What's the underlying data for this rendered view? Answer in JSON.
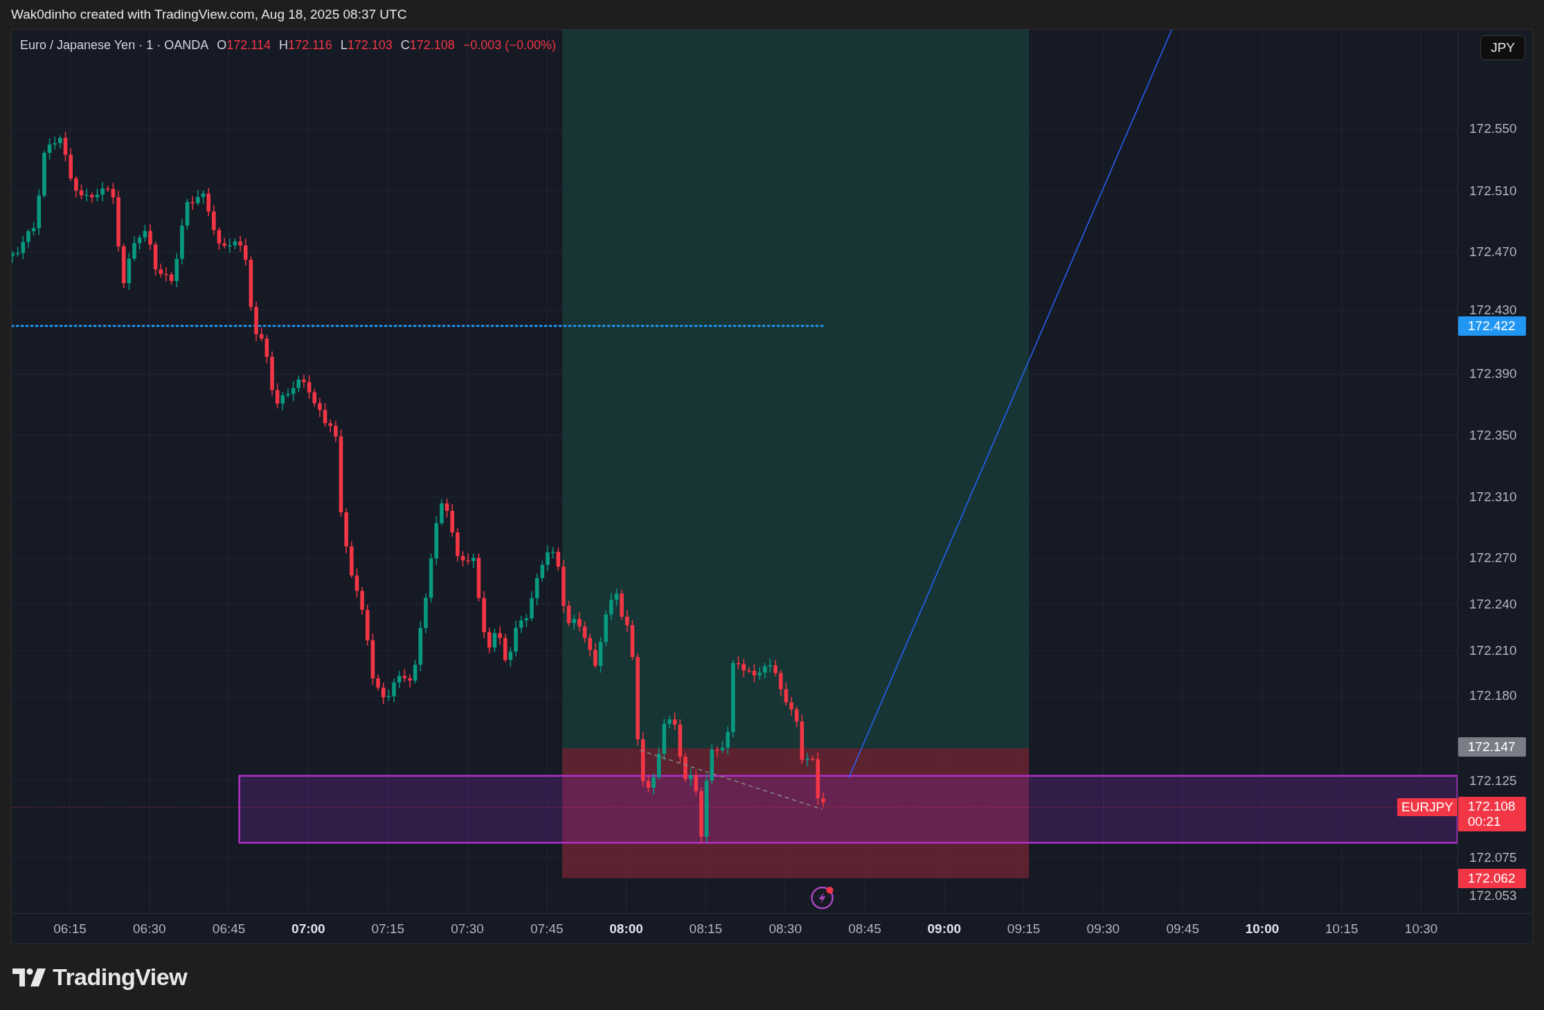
{
  "header": {
    "caption": "Wak0dinho created with TradingView.com, Aug 18, 2025 08:37 UTC"
  },
  "legend": {
    "symbol": "Euro / Japanese Yen · 1 · OANDA",
    "values": [
      {
        "label": "O",
        "value": "172.114"
      },
      {
        "label": "H",
        "value": "172.116"
      },
      {
        "label": "L",
        "value": "172.103"
      },
      {
        "label": "C",
        "value": "172.108"
      }
    ],
    "change": "−0.003 (−0.00%)"
  },
  "currency_button": "JPY",
  "price_axis": [
    "172.550",
    "172.510",
    "172.470",
    "172.430",
    "172.390",
    "172.350",
    "172.310",
    "172.270",
    "172.240",
    "172.210",
    "172.180",
    "172.125",
    "172.075",
    "172.053"
  ],
  "price_badges": [
    {
      "kind": "alert",
      "value": "172.422",
      "color": "#2196f3"
    },
    {
      "kind": "target",
      "value": "172.147",
      "color": "#7a7d86"
    },
    {
      "kind": "last",
      "value": "172.108",
      "countdown": "00:21",
      "symbol": "EURJPY",
      "color": "#f23645"
    },
    {
      "kind": "stop",
      "value": "172.062",
      "color": "#f23645"
    }
  ],
  "time_axis": [
    {
      "label": "06:15",
      "major": false
    },
    {
      "label": "06:30",
      "major": false
    },
    {
      "label": "06:45",
      "major": false
    },
    {
      "label": "07:00",
      "major": true
    },
    {
      "label": "07:15",
      "major": false
    },
    {
      "label": "07:30",
      "major": false
    },
    {
      "label": "07:45",
      "major": false
    },
    {
      "label": "08:00",
      "major": true
    },
    {
      "label": "08:15",
      "major": false
    },
    {
      "label": "08:30",
      "major": false
    },
    {
      "label": "08:45",
      "major": false
    },
    {
      "label": "09:00",
      "major": true
    },
    {
      "label": "09:15",
      "major": false
    },
    {
      "label": "09:30",
      "major": false
    },
    {
      "label": "09:45",
      "major": false
    },
    {
      "label": "10:00",
      "major": true
    },
    {
      "label": "10:15",
      "major": false
    },
    {
      "label": "10:30",
      "major": false
    }
  ],
  "footer": {
    "brand": "TradingView"
  }
}
